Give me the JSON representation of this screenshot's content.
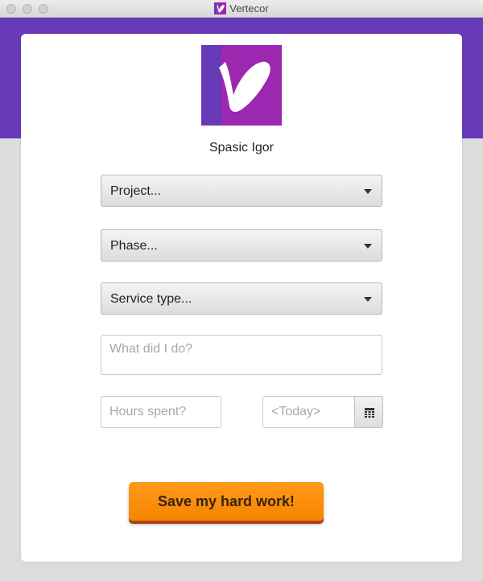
{
  "window": {
    "title": "Vertecor",
    "app_icon": "vertecor-logo-icon"
  },
  "theme": {
    "brand_purple": "#673ab7",
    "logo_magenta": "#9c27b0",
    "accent_orange": "#f58400"
  },
  "user": {
    "name": "Spasic Igor"
  },
  "form": {
    "project_select": {
      "label": "Project..."
    },
    "phase_select": {
      "label": "Phase..."
    },
    "service_type_select": {
      "label": "Service type..."
    },
    "description": {
      "placeholder": "What did I do?",
      "value": ""
    },
    "hours": {
      "placeholder": "Hours spent?",
      "value": ""
    },
    "date": {
      "placeholder": "<Today>",
      "value": "",
      "picker_icon": "calendar-icon"
    },
    "save_label": "Save my hard work!"
  }
}
